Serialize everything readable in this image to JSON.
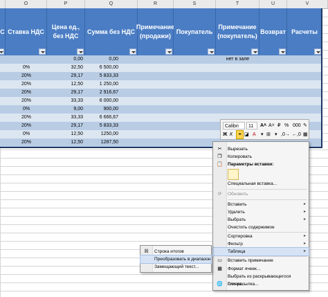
{
  "columns": [
    "O",
    "P",
    "Q",
    "R",
    "S",
    "T",
    "U",
    "V"
  ],
  "headers": [
    "С",
    "Ставка НДС",
    "Цена ед., без НДС",
    "Сумма без НДС",
    "Примечание (продажи)",
    "Покупатель",
    "Примечание (покупатель)",
    "Возврат",
    "Расчеты"
  ],
  "rows": [
    {
      "vat": "",
      "price": "0,00",
      "sum": "0,00",
      "note": "нет в зале"
    },
    {
      "vat": "0%",
      "price": "32,50",
      "sum": "6 500,00",
      "note": ""
    },
    {
      "vat": "20%",
      "price": "29,17",
      "sum": "5 833,33",
      "note": ""
    },
    {
      "vat": "20%",
      "price": "12,50",
      "sum": "1 250,00",
      "note": ""
    },
    {
      "vat": "20%",
      "price": "29,17",
      "sum": "2 916,67",
      "note": ""
    },
    {
      "vat": "20%",
      "price": "33,33",
      "sum": "6 000,00",
      "note": ""
    },
    {
      "vat": "0%",
      "price": "9,00",
      "sum": "900,00",
      "note": ""
    },
    {
      "vat": "20%",
      "price": "33,33",
      "sum": "6 666,67",
      "note": ""
    },
    {
      "vat": "20%",
      "price": "29,17",
      "sum": "5 833,33",
      "note": ""
    },
    {
      "vat": "0%",
      "price": "12,50",
      "sum": "1250,00",
      "note": ""
    },
    {
      "vat": "20%",
      "price": "12,50",
      "sum": "1287,50",
      "note": ""
    }
  ],
  "mini_toolbar": {
    "font": "Calibri",
    "size": "11",
    "percent": "%"
  },
  "context_menu": {
    "cut": "Вырезать",
    "copy": "Копировать",
    "paste_options": "Параметры вставки:",
    "paste_special": "Специальная вставка...",
    "refresh": "Обновить",
    "insert": "Вставить",
    "delete": "Удалить",
    "select": "Выбрать",
    "clear": "Очистить содержимое",
    "sort": "Сортировка",
    "filter": "Фильтр",
    "table": "Таблица",
    "insert_comment": "Вставить примечание",
    "format_cells": "Формат ячеек...",
    "pick_list": "Выбрать из раскрывающегося списка...",
    "hyperlink": "Гиперссылка..."
  },
  "submenu": {
    "totals_row": "Строка итогов",
    "convert": "Преобразовать в диапазон",
    "alt_text": "Замещающий текст..."
  }
}
